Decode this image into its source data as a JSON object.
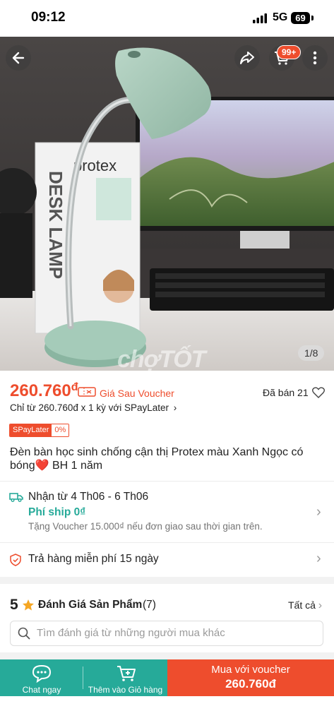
{
  "status_bar": {
    "time": "09:12",
    "network": "5G",
    "battery": "69"
  },
  "header": {
    "cart_badge": "99+"
  },
  "gallery": {
    "counter": "1/8",
    "watermark": "chợTỐT"
  },
  "product": {
    "price": "260.760",
    "currency": "đ",
    "voucher_label": "Giá Sau Voucher",
    "sold": "Đã bán 21",
    "installment": "Chỉ từ 260.760đ x 1 kỳ với SPayLater",
    "spaylater_tag": "SPayLater",
    "spaylater_rate": "0%",
    "title": "Đèn bàn học sinh chống cận thị Protex màu Xanh Ngọc có bóng❤️ BH 1 năm"
  },
  "shipping": {
    "delivery": "Nhận từ 4 Th06 - 6 Th06",
    "fee": "Phí ship 0₫",
    "voucher_note": "Tặng Voucher 15.000₫ nếu đơn giao sau thời gian trên."
  },
  "returns": {
    "text": "Trả hàng miễn phí 15 ngày"
  },
  "reviews": {
    "score": "5",
    "label": "Đánh Giá Sản Phẩm",
    "count": "(7)",
    "see_all": "Tất cả",
    "search_placeholder": "Tìm đánh giá từ những người mua khác"
  },
  "bottom_bar": {
    "chat_label": "Chat ngay",
    "cart_label": "Thêm vào Giỏ hàng",
    "buy_label": "Mua với voucher",
    "buy_price": "260.760đ"
  },
  "colors": {
    "primary": "#ee4d2d",
    "teal": "#26aa99"
  }
}
